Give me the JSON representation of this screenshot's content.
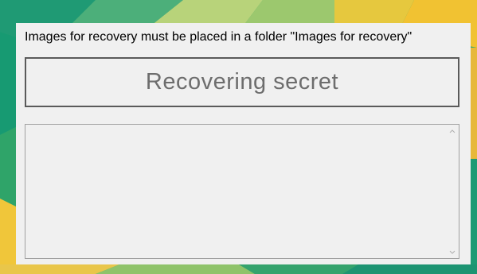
{
  "window": {
    "instruction_text": "Images for recovery must be placed in a folder \"Images for recovery\"",
    "recover_button_label": "Recovering secret",
    "output_text": ""
  },
  "icons": {
    "scroll_up": "chevron-up-icon",
    "scroll_down": "chevron-down-icon"
  },
  "colors": {
    "window_bg": "#f0f0f0",
    "button_border": "#5a5a5a",
    "button_text": "#6d6d6d",
    "textbox_border": "#a0a0a0"
  }
}
